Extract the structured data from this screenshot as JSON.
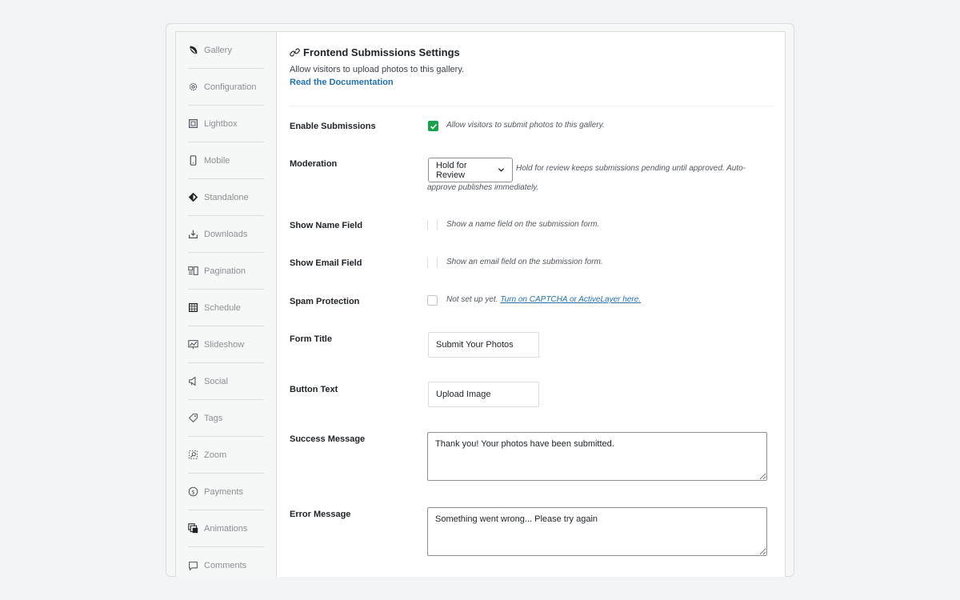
{
  "sidebar": {
    "items": [
      {
        "label": "Gallery",
        "icon": "leaf-icon"
      },
      {
        "label": "Configuration",
        "icon": "gear-icon"
      },
      {
        "label": "Lightbox",
        "icon": "lightbox-icon"
      },
      {
        "label": "Mobile",
        "icon": "mobile-icon"
      },
      {
        "label": "Standalone",
        "icon": "standalone-icon"
      },
      {
        "label": "Downloads",
        "icon": "download-icon"
      },
      {
        "label": "Pagination",
        "icon": "pagination-icon"
      },
      {
        "label": "Schedule",
        "icon": "calendar-icon"
      },
      {
        "label": "Slideshow",
        "icon": "slideshow-icon"
      },
      {
        "label": "Social",
        "icon": "megaphone-icon"
      },
      {
        "label": "Tags",
        "icon": "tag-icon"
      },
      {
        "label": "Zoom",
        "icon": "zoom-icon"
      },
      {
        "label": "Payments",
        "icon": "dollar-icon"
      },
      {
        "label": "Animations",
        "icon": "animations-icon"
      },
      {
        "label": "Comments",
        "icon": "comment-icon"
      }
    ]
  },
  "header": {
    "title": "Frontend Submissions Settings",
    "description": "Allow visitors to upload photos to this gallery.",
    "doc_link": "Read the Documentation"
  },
  "settings": {
    "enable_submissions": {
      "label": "Enable Submissions",
      "checked": true,
      "note": "Allow visitors to submit photos to this gallery."
    },
    "moderation": {
      "label": "Moderation",
      "value": "Hold for Review",
      "note_line1": "Hold for review keeps submissions pending until approved. Auto-",
      "note_line2": "approve publishes immediately."
    },
    "show_name": {
      "label": "Show Name Field",
      "note": "Show a name field on the submission form."
    },
    "show_email": {
      "label": "Show Email Field",
      "note": "Show an email field on the submission form."
    },
    "spam": {
      "label": "Spam Protection",
      "note": "Not set up yet.",
      "link": "Turn on CAPTCHA or ActiveLayer here."
    },
    "form_title": {
      "label": "Form Title",
      "value": "Submit Your Photos"
    },
    "button_text": {
      "label": "Button Text",
      "value": "Upload Image"
    },
    "success_message": {
      "label": "Success Message",
      "value": "Thank you! Your photos have been submitted."
    },
    "error_message": {
      "label": "Error Message",
      "value": "Something went wrong... Please try again"
    }
  },
  "colors": {
    "accent": "#2271b1",
    "check": "#17a34a"
  }
}
